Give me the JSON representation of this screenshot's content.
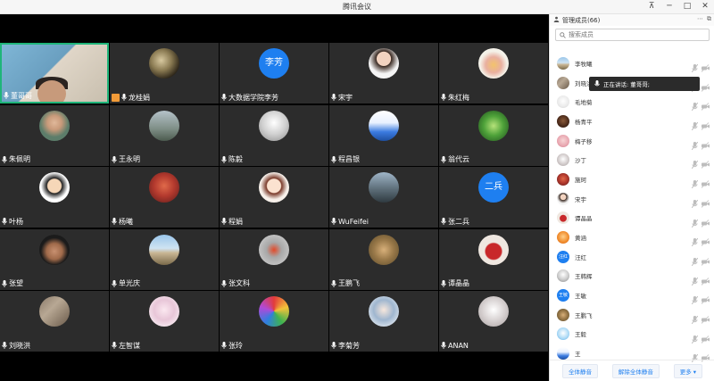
{
  "window": {
    "title": "腾讯会议"
  },
  "colors": {
    "accent": "#1e7ff0",
    "active_border": "#1fb57a",
    "host_badge": "#f29b38",
    "video_bg": "#000000",
    "tile_bg": "#2c2c2c"
  },
  "tiles": [
    {
      "name": "董哥哥",
      "avatar": "camera"
    },
    {
      "name": "龙桂娟",
      "avatar": "leopard",
      "host": true
    },
    {
      "name": "大数据学院李芳",
      "avatar": "text",
      "avatar_text": "李芳"
    },
    {
      "name": "宋宇",
      "avatar": "girl"
    },
    {
      "name": "朱红梅",
      "avatar": "cake"
    },
    {
      "name": "朱佩明",
      "avatar": "man"
    },
    {
      "name": "王永明",
      "avatar": "building"
    },
    {
      "name": "陈毅",
      "avatar": "sky"
    },
    {
      "name": "程昌银",
      "avatar": "cartoon"
    },
    {
      "name": "翁代云",
      "avatar": "leaf"
    },
    {
      "name": "叶杨",
      "avatar": "cartoon-man"
    },
    {
      "name": "杨曦",
      "avatar": "red"
    },
    {
      "name": "程娟",
      "avatar": "anime-girl"
    },
    {
      "name": "WuFeifei",
      "avatar": "street"
    },
    {
      "name": "张二兵",
      "avatar": "text",
      "avatar_text": "二兵"
    },
    {
      "name": "张望",
      "avatar": "face"
    },
    {
      "name": "单光庆",
      "avatar": "landscape"
    },
    {
      "name": "张文科",
      "avatar": "fire"
    },
    {
      "name": "王鹏飞",
      "avatar": "cat"
    },
    {
      "name": "谭晶晶",
      "avatar": "vase"
    },
    {
      "name": "刘晓洪",
      "avatar": "crowd"
    },
    {
      "name": "左智谋",
      "avatar": "anime"
    },
    {
      "name": "张玲",
      "avatar": "balls"
    },
    {
      "name": "李菊芳",
      "avatar": "doll"
    },
    {
      "name": "ANAN",
      "avatar": "gray"
    }
  ],
  "panel": {
    "title": "管理成员(66)",
    "search_placeholder": "搜索成员",
    "tooltip": "正在讲话: 董哥哥;",
    "members": [
      {
        "name": "李牧曦",
        "avatar": "landscape"
      },
      {
        "name": "刘晓洪",
        "avatar": "crowd"
      },
      {
        "name": "毛地菊",
        "avatar": "white"
      },
      {
        "name": "杨青平",
        "avatar": "dark"
      },
      {
        "name": "梅子移",
        "avatar": "pink"
      },
      {
        "name": "沙丁",
        "avatar": "gray"
      },
      {
        "name": "施珂",
        "avatar": "red"
      },
      {
        "name": "宋宇",
        "avatar": "girl"
      },
      {
        "name": "谭晶晶",
        "avatar": "vase"
      },
      {
        "name": "黄涵",
        "avatar": "orange"
      },
      {
        "name": "汪红",
        "avatar": "text",
        "avatar_text": "汪红"
      },
      {
        "name": "王韩辉",
        "avatar": "sky"
      },
      {
        "name": "王敏",
        "avatar": "text",
        "avatar_text": "王敏"
      },
      {
        "name": "王鹏飞",
        "avatar": "cat"
      },
      {
        "name": "王毅",
        "avatar": "cloud"
      },
      {
        "name": "王",
        "avatar": "cartoon"
      }
    ],
    "footer": {
      "mute_all": "全体静音",
      "unmute_all": "解除全体静音",
      "more": "更多 ▾"
    }
  }
}
